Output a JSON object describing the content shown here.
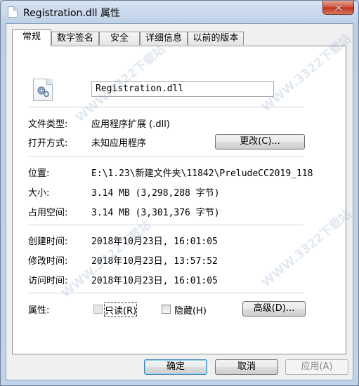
{
  "window": {
    "title": "Registration.dll 属性"
  },
  "tabs": [
    {
      "label": "常规",
      "active": true
    },
    {
      "label": "数字签名",
      "active": false
    },
    {
      "label": "安全",
      "active": false
    },
    {
      "label": "详细信息",
      "active": false
    },
    {
      "label": "以前的版本",
      "active": false
    }
  ],
  "general": {
    "filename": "Registration.dll",
    "file_type_label": "文件类型:",
    "file_type_value": "应用程序扩展 (.dll)",
    "opens_with_label": "打开方式:",
    "opens_with_value": "未知应用程序",
    "change_button": "更改(C)...",
    "location_label": "位置:",
    "location_value": "E:\\1.23\\新建文件夹\\11842\\PreludeCC2019_118",
    "size_label": "大小:",
    "size_value": "3.14 MB (3,298,288 字节)",
    "size_on_disk_label": "占用空间:",
    "size_on_disk_value": "3.14 MB (3,301,376 字节)",
    "created_label": "创建时间:",
    "created_value": "2018年10月23日, 16:01:05",
    "modified_label": "修改时间:",
    "modified_value": "2018年10月23日, 13:57:52",
    "accessed_label": "访问时间:",
    "accessed_value": "2018年10月23日, 16:01:05",
    "attributes_label": "属性:",
    "readonly_label": "只读(R)",
    "hidden_label": "隐藏(H)",
    "advanced_button": "高级(D)..."
  },
  "footer": {
    "ok_button": "确定",
    "cancel_button": "取消",
    "apply_button": "应用(A)"
  },
  "watermark": {
    "text": "WWW.3322下载站"
  },
  "colors": {
    "close_button": "#c1321d",
    "default_button_border": "#3c7fb1"
  }
}
